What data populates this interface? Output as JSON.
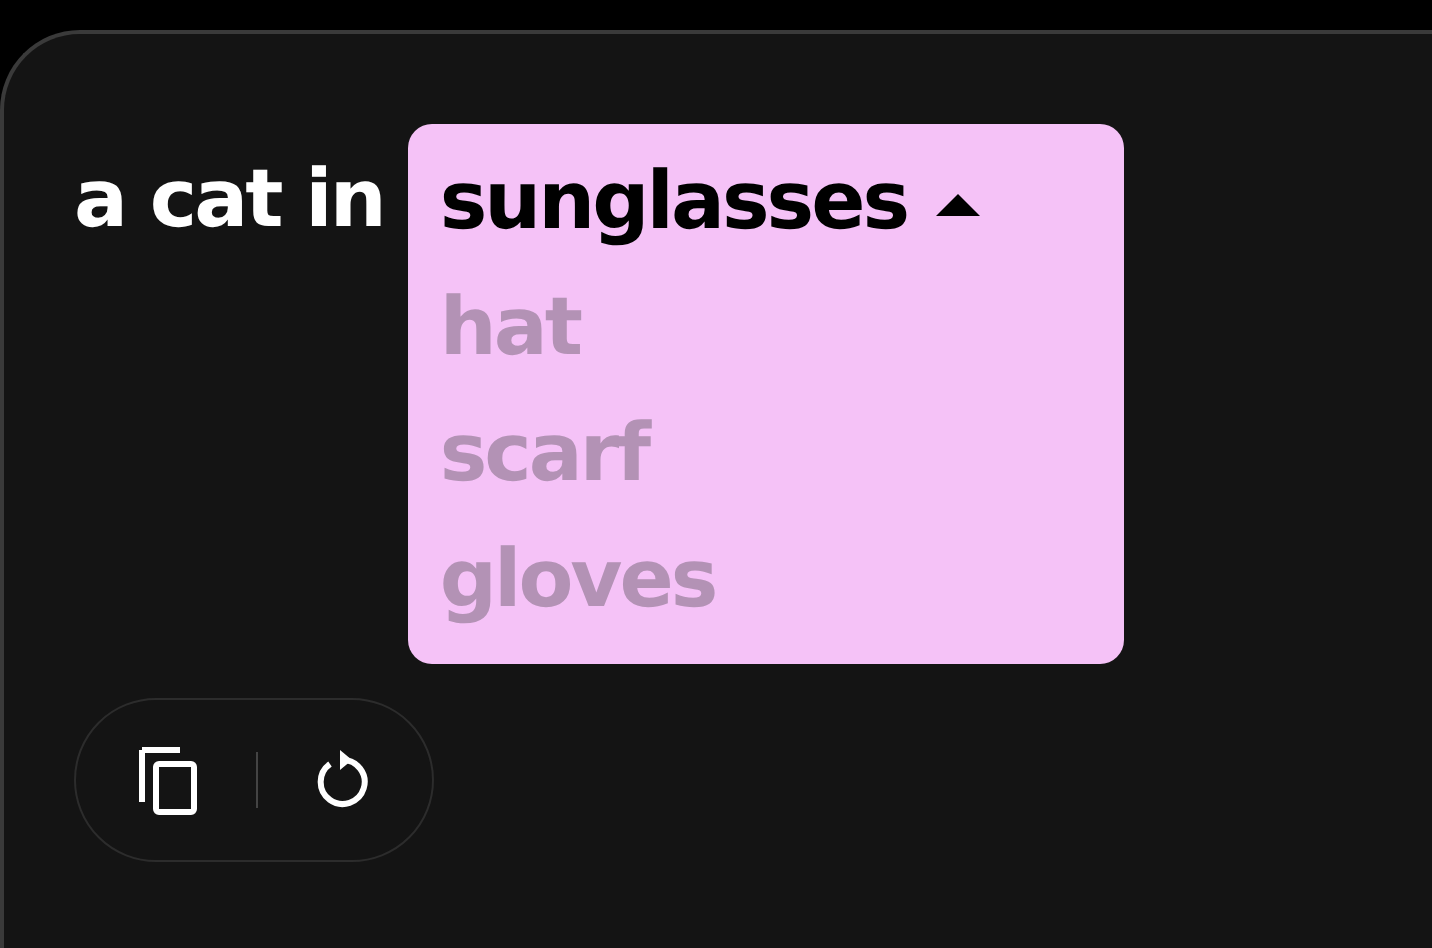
{
  "prompt": {
    "prefix": "a cat in",
    "dropdown": {
      "expanded": true,
      "options": [
        {
          "label": "sunglasses",
          "selected": true
        },
        {
          "label": "hat",
          "selected": false
        },
        {
          "label": "scarf",
          "selected": false
        },
        {
          "label": "gloves",
          "selected": false
        }
      ]
    }
  }
}
